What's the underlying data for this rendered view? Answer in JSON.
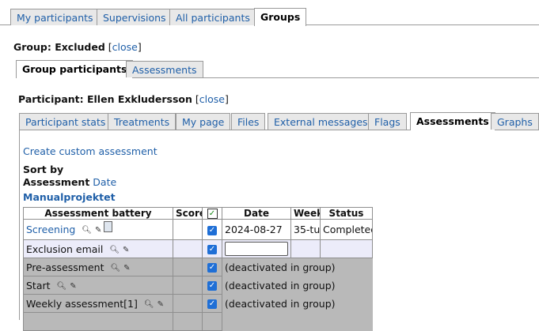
{
  "top_tabs": [
    "My participants",
    "Supervisions",
    "All participants",
    "Groups"
  ],
  "group_line": {
    "label": "Group: Excluded",
    "close": "close"
  },
  "group_tabs": [
    "Group participants",
    "Assessments"
  ],
  "participant_line": {
    "label": "Participant: Ellen Exkludersson",
    "close": "close"
  },
  "participant_tabs": [
    "Participant stats",
    "Treatments",
    "My page",
    "Files",
    "External messages",
    "Flags",
    "Assessments",
    "Graphs"
  ],
  "create_link": "Create custom assessment",
  "sort": {
    "label": "Sort by",
    "assessment": "Assessment",
    "date": "Date"
  },
  "project_name": "Manualprojektet",
  "table": {
    "headers": {
      "battery": "Assessment battery",
      "score": "Score",
      "check": "✓",
      "date": "Date",
      "week": "Week",
      "status": "Status"
    },
    "rows": [
      {
        "name": "Screening",
        "checked": true,
        "date": "2024-08-27",
        "week": "35-tu",
        "status": "Completed"
      },
      {
        "name": "Exclusion email",
        "checked": true,
        "date_input": true
      },
      {
        "name": "Pre-assessment",
        "checked": true,
        "note": "(deactivated in group)"
      },
      {
        "name": "Start",
        "checked": true,
        "note": "(deactivated in group)"
      },
      {
        "name": "Weekly assessment[1]",
        "checked": true,
        "note": "(deactivated in group)"
      }
    ]
  },
  "icons": {
    "search": "search-icon",
    "edit": "edit-pencil-icon",
    "copy": "copy-documents-icon",
    "check": "checkbox-checked-icon"
  },
  "colors": {
    "link": "#1f5fa8",
    "tab_bg": "#e8e8e8",
    "row_highlight": "#ececfa",
    "row_deactivated": "#b9b9b9",
    "checkbox": "#1f6fd6"
  }
}
